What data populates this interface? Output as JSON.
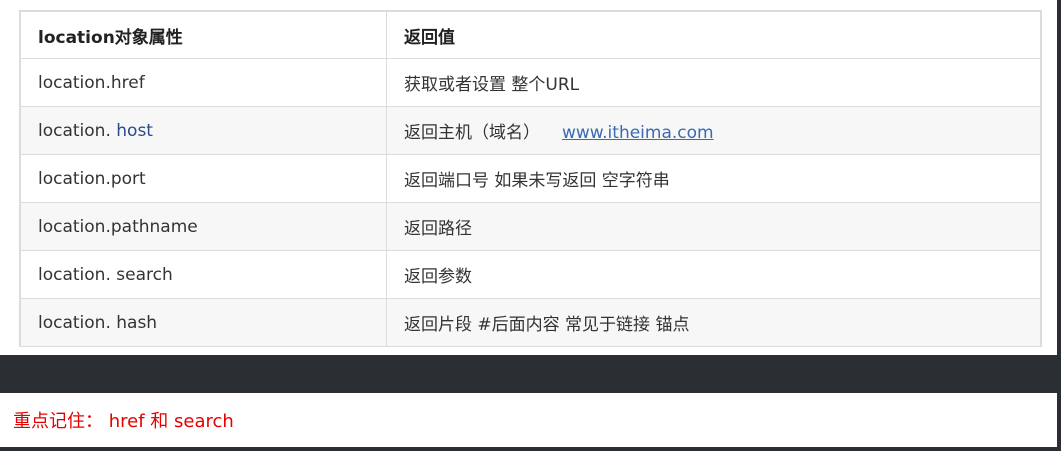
{
  "table": {
    "headers": [
      "location对象属性",
      "返回值"
    ],
    "rows": [
      {
        "prop": " location.href",
        "desc": "获取或者设置 整个URL"
      },
      {
        "prop_a": "location. ",
        "prop_b": "host",
        "desc": "返回主机（域名）",
        "link": "www.itheima.com"
      },
      {
        "prop": "location.port",
        "desc": "返回端口号  如果未写返回 空字符串"
      },
      {
        "prop": "location.pathname",
        "desc": "返回路径"
      },
      {
        "prop": "location. search",
        "desc": "返回参数"
      },
      {
        "prop": "location. hash",
        "desc": "返回片段  #后面内容 常见于链接 锚点"
      }
    ]
  },
  "note": "重点记住： href 和 search",
  "colors": {
    "note": "#e60000",
    "link": "#3a6ab0",
    "host": "#2a4a8a"
  }
}
